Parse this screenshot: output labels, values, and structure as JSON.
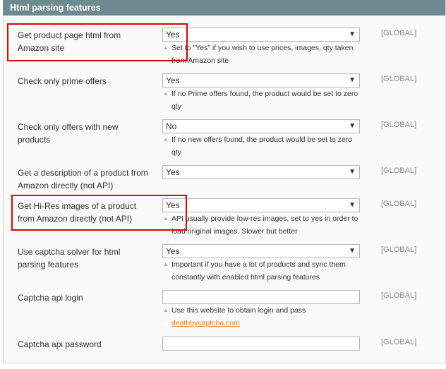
{
  "section_title": "Html parsing features",
  "rows": [
    {
      "label": "Get product page html from Amazon site",
      "value": "Yes",
      "note": "Set to \"Yes\" if you wish to use prices, images, qty taken from Amazon site",
      "scope": "[GLOBAL]"
    },
    {
      "label": "Check only prime offers",
      "value": "Yes",
      "note": "If no Prime offers found, the product would be set to zero qty",
      "scope": "[GLOBAL]"
    },
    {
      "label": "Check only offers with new products",
      "value": "No",
      "note": "If no new offers found, the product would be set to zero qty",
      "scope": "[GLOBAL]"
    },
    {
      "label": "Get a description of a product from Amazon directly (not API)",
      "value": "Yes",
      "note": "",
      "scope": "[GLOBAL]"
    },
    {
      "label": "Get Hi-Res images of a product from Amazon directly (not API)",
      "value": "Yes",
      "note": "API usually provide low-res images, set to yes in order to load original images. Slower but better",
      "scope": "[GLOBAL]"
    },
    {
      "label": "Use captcha solver for html parsing features",
      "value": "Yes",
      "note": "Important if you have a lot of products and sync them constantly with enabled html parsing features",
      "scope": "[GLOBAL]"
    },
    {
      "label": "Captcha api login",
      "value": "",
      "note": "Use this website to obtain login and pass",
      "link": "deathbycaptcha.com",
      "scope": "[GLOBAL]"
    },
    {
      "label": "Captcha api password",
      "value": "",
      "scope": "[GLOBAL]"
    }
  ],
  "highlight_color": "#e00000"
}
